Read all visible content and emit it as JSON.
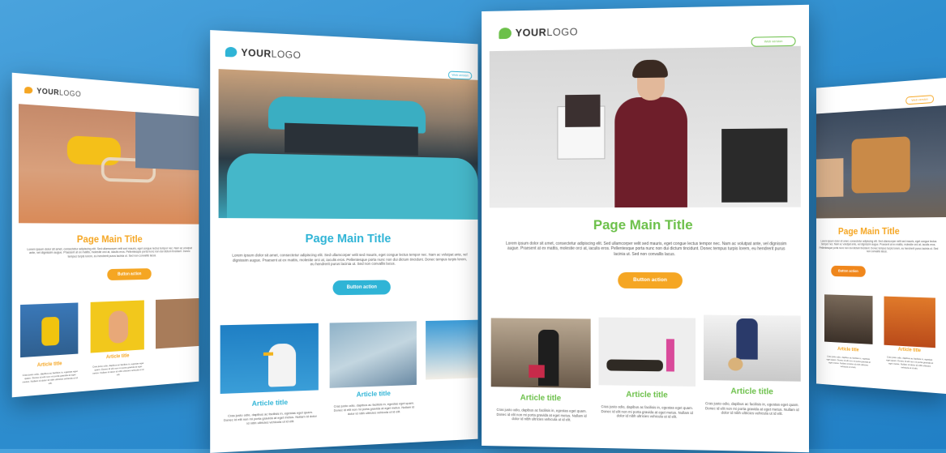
{
  "logo": {
    "bold": "YOUR",
    "light": "LOGO"
  },
  "page_title": "Page Main Title",
  "intro_text": "Lorem ipsum dolor sit amet, consectetur adipiscing elit. Sed ullamcorper velit sed mauris, eget congue lectus tempor nec. Nam ac volutpat ante, vel dignissim augue. Praesent at ex mattis, molestie orci at, iaculis eros. Pellentesque porta nunc non dui dictum tincidunt. Donec tempus turpis lorem, eu hendrerit purus lacinia ut. Sed non convallis lacus.",
  "button_label": "Button action",
  "header_link": "Web version",
  "article_title": "Article title",
  "article_text": "Cras justo odio, dapibus ac facilisis in, egestas eget quam. Donec id elit non mi porta gravida at eget metus. Nullam id dolor id nibh ultricies vehicula ut id elit.",
  "colors": {
    "orange": "#f5a623",
    "blue": "#2fb4d6",
    "green": "#6cc04a",
    "background": "#2f8fd0"
  }
}
